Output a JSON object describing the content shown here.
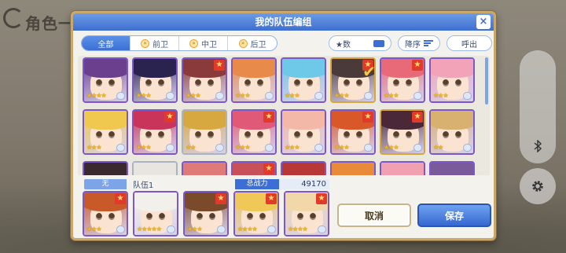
{
  "background": {
    "title": "角色一览"
  },
  "dialog": {
    "title": "我的队伍编组",
    "close_label": "×"
  },
  "toolbar": {
    "tabs": [
      {
        "label": "全部",
        "active": true
      },
      {
        "label": "前卫",
        "active": false
      },
      {
        "label": "中卫",
        "active": false
      },
      {
        "label": "后卫",
        "active": false
      }
    ],
    "star_filter_label": "★数",
    "sort_label": "降序",
    "call_label": "呼出"
  },
  "grid": {
    "rows": [
      [
        {
          "hair": "#6b3f8e",
          "border": "purple",
          "stars": "★★★★",
          "corner": false,
          "check": false
        },
        {
          "hair": "#2a2350",
          "border": "purple",
          "stars": "★★★",
          "corner": false,
          "check": false
        },
        {
          "hair": "#8a3a3a",
          "border": "purple",
          "stars": "★★★",
          "corner": true,
          "check": false
        },
        {
          "hair": "#e88a4a",
          "border": "purple",
          "stars": "★★★",
          "corner": false,
          "check": false
        },
        {
          "hair": "#6ec8e8",
          "border": "purple",
          "stars": "★★★",
          "corner": false,
          "check": false
        },
        {
          "hair": "#4a3a3a",
          "border": "gold",
          "stars": "★★★",
          "corner": true,
          "check": true
        },
        {
          "hair": "#e86a78",
          "border": "purple",
          "stars": "★★★",
          "corner": true,
          "check": false
        },
        {
          "hair": "#f2a3b8",
          "border": "purple",
          "stars": "★★★",
          "corner": false,
          "check": false
        }
      ],
      [
        {
          "hair": "#f0c850",
          "border": "purple",
          "stars": "★★★",
          "corner": false,
          "check": false
        },
        {
          "hair": "#c8345a",
          "border": "purple",
          "stars": "★★★",
          "corner": true,
          "check": false
        },
        {
          "hair": "#d8a840",
          "border": "silver",
          "stars": "★★",
          "corner": false,
          "check": false
        },
        {
          "hair": "#e05a78",
          "border": "purple",
          "stars": "★★★",
          "corner": true,
          "check": false
        },
        {
          "hair": "#f4b8a8",
          "border": "purple",
          "stars": "★★★",
          "corner": false,
          "check": false
        },
        {
          "hair": "#d8582a",
          "border": "purple",
          "stars": "★★★",
          "corner": true,
          "check": false
        },
        {
          "hair": "#4a2838",
          "border": "gold",
          "stars": "★★★",
          "corner": true,
          "check": false
        },
        {
          "hair": "#d8b070",
          "border": "purple",
          "stars": "★★",
          "corner": false,
          "check": false
        }
      ],
      [
        {
          "hair": "#3a2a30",
          "border": "purple",
          "stars": "",
          "corner": false,
          "check": false
        },
        {
          "hair": "#e8e4e0",
          "border": "silver",
          "stars": "",
          "corner": false,
          "check": false
        },
        {
          "hair": "#e07a78",
          "border": "purple",
          "stars": "",
          "corner": false,
          "check": false
        },
        {
          "hair": "#c85058",
          "border": "purple",
          "stars": "",
          "corner": true,
          "check": false
        },
        {
          "hair": "#b83838",
          "border": "purple",
          "stars": "",
          "corner": false,
          "check": false
        },
        {
          "hair": "#e88a3a",
          "border": "purple",
          "stars": "",
          "corner": false,
          "check": false
        },
        {
          "hair": "#f0a0b0",
          "border": "purple",
          "stars": "",
          "corner": false,
          "check": false
        },
        {
          "hair": "#7a5a9a",
          "border": "purple",
          "stars": "",
          "corner": false,
          "check": false
        }
      ]
    ]
  },
  "party": {
    "slot_badge": "无",
    "team_name": "队伍1",
    "power_label": "总战力",
    "power_value": "49170",
    "members": [
      {
        "hair": "#c85a2a",
        "border": "purple",
        "stars": "★★★",
        "corner": true
      },
      {
        "hair": "#f2f0ea",
        "border": "purple",
        "stars": "★★★★★",
        "corner": false
      },
      {
        "hair": "#7a4a2a",
        "border": "purple",
        "stars": "★★★",
        "corner": true
      },
      {
        "hair": "#f0c858",
        "border": "purple",
        "stars": "★★★★",
        "corner": true
      },
      {
        "hair": "#f2d8a8",
        "border": "purple",
        "stars": "★★★★",
        "corner": true
      }
    ],
    "cancel_label": "取消",
    "save_label": "保存"
  },
  "side": {
    "bluetooth_icon": "bluetooth-icon",
    "settings_icon": "gear-icon"
  }
}
